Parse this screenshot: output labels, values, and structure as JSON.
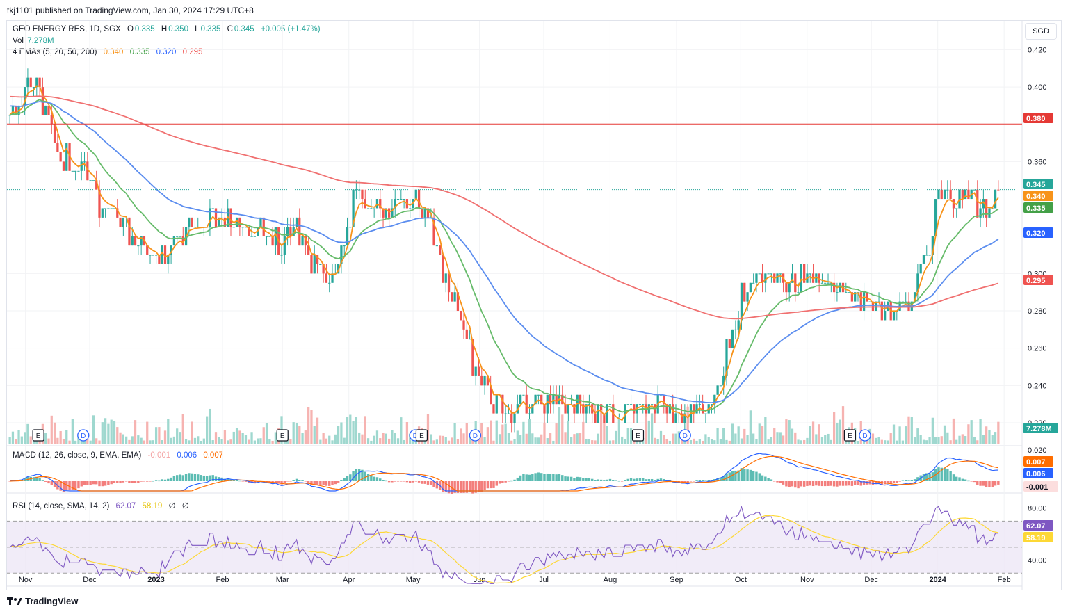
{
  "header": {
    "published": "tkj1101 published on TradingView.com, Jan 30, 2024 17:29 UTC+8",
    "symbol": "GEO ENERGY RES, 1D, SGX",
    "o_label": "O",
    "o_val": "0.335",
    "h_label": "H",
    "h_val": "0.350",
    "l_label": "L",
    "l_val": "0.335",
    "c_label": "C",
    "c_val": "0.345",
    "change": "+0.005 (+1.47%)",
    "vol_label": "Vol",
    "vol_val": "7.278M",
    "ema_label": "4 EMAs (5, 20, 50, 200)",
    "ema5": "0.340",
    "ema20": "0.335",
    "ema50": "0.320",
    "ema200": "0.295",
    "currency": "SGD"
  },
  "macd_legend": {
    "label": "MACD (12, 26, close, 9, EMA, EMA)",
    "hist": "-0.001",
    "macd": "0.006",
    "signal": "0.007"
  },
  "rsi_legend": {
    "label": "RSI (14, close, SMA, 14, 2)",
    "rsi": "62.07",
    "sma": "58.19",
    "extra1": "∅",
    "extra2": "∅"
  },
  "footer": {
    "brand": "TradingView"
  },
  "colors": {
    "up": "#26a69a",
    "down": "#ef5350",
    "ema5": "#f7931a",
    "ema20": "#66bb6a",
    "ema50": "#5b8def",
    "ema200": "#f07070",
    "level": "#e53935",
    "macd": "#2962ff",
    "signal": "#ff6d00",
    "rsi": "#7e57c2",
    "rsima": "#fdd835"
  },
  "price_axis": [
    "0.420",
    "0.400",
    "0.360",
    "0.300",
    "0.280",
    "0.260",
    "0.240",
    "0.220"
  ],
  "macd_axis": [
    "0.020"
  ],
  "rsi_axis": [
    "80.00",
    "40.00"
  ],
  "time_axis": [
    "Nov",
    "Dec",
    "2023",
    "Feb",
    "Mar",
    "Apr",
    "May",
    "Jun",
    "Jul",
    "Aug",
    "Sep",
    "Oct",
    "Nov",
    "Dec",
    "2024",
    "Feb"
  ],
  "price_tags": [
    {
      "text": "0.380",
      "color": "#e53935"
    },
    {
      "text": "0.345",
      "color": "#26a69a"
    },
    {
      "text": "0.340",
      "color": "#f7931a"
    },
    {
      "text": "0.335",
      "color": "#43a047"
    },
    {
      "text": "0.320",
      "color": "#2962ff"
    },
    {
      "text": "0.295",
      "color": "#ef5350"
    },
    {
      "text": "7.278M",
      "color": "#26a69a"
    }
  ],
  "macd_tags": [
    {
      "text": "0.007",
      "color": "#ff6d00"
    },
    {
      "text": "0.006",
      "color": "#2962ff"
    },
    {
      "text": "-0.001",
      "color": "#fcdede"
    }
  ],
  "rsi_tags": [
    {
      "text": "62.07",
      "color": "#7e57c2"
    },
    {
      "text": "58.19",
      "color": "#fdd835"
    }
  ],
  "markers": [
    {
      "month": "Nov",
      "type": "E"
    },
    {
      "month": "Nov",
      "type": "D"
    },
    {
      "month": "Mar",
      "type": "E"
    },
    {
      "month": "May",
      "type": "D"
    },
    {
      "month": "May",
      "type": "E"
    },
    {
      "month": "Jun",
      "type": "D"
    },
    {
      "month": "Aug",
      "type": "E"
    },
    {
      "month": "Sep",
      "type": "D"
    },
    {
      "month": "Nov",
      "type": "E"
    },
    {
      "month": "Nov",
      "type": "D"
    }
  ],
  "chart_data": {
    "type": "candlestick",
    "title": "GEO ENERGY RES, 1D, SGX",
    "ylim": [
      0.22,
      0.425
    ],
    "horizontal_level": 0.38,
    "last_price": 0.345,
    "close_path": [
      [
        "2022-10-24",
        0.385
      ],
      [
        "2022-11-01",
        0.405
      ],
      [
        "2022-11-07",
        0.395
      ],
      [
        "2022-11-14",
        0.365
      ],
      [
        "2022-11-21",
        0.36
      ],
      [
        "2022-11-28",
        0.36
      ],
      [
        "2022-12-05",
        0.335
      ],
      [
        "2022-12-12",
        0.33
      ],
      [
        "2022-12-19",
        0.32
      ],
      [
        "2022-12-27",
        0.315
      ],
      [
        "2023-01-03",
        0.31
      ],
      [
        "2023-01-16",
        0.325
      ],
      [
        "2023-01-30",
        0.33
      ],
      [
        "2023-02-13",
        0.325
      ],
      [
        "2023-02-27",
        0.315
      ],
      [
        "2023-03-06",
        0.325
      ],
      [
        "2023-03-20",
        0.295
      ],
      [
        "2023-03-27",
        0.31
      ],
      [
        "2023-04-03",
        0.34
      ],
      [
        "2023-04-17",
        0.335
      ],
      [
        "2023-05-02",
        0.34
      ],
      [
        "2023-05-08",
        0.33
      ],
      [
        "2023-05-15",
        0.3
      ],
      [
        "2023-05-22",
        0.275
      ],
      [
        "2023-06-01",
        0.24
      ],
      [
        "2023-06-12",
        0.225
      ],
      [
        "2023-06-26",
        0.23
      ],
      [
        "2023-07-10",
        0.23
      ],
      [
        "2023-07-24",
        0.225
      ],
      [
        "2023-08-07",
        0.225
      ],
      [
        "2023-08-21",
        0.23
      ],
      [
        "2023-09-04",
        0.225
      ],
      [
        "2023-09-18",
        0.23
      ],
      [
        "2023-09-25",
        0.26
      ],
      [
        "2023-10-02",
        0.29
      ],
      [
        "2023-10-09",
        0.3
      ],
      [
        "2023-10-23",
        0.295
      ],
      [
        "2023-11-06",
        0.3
      ],
      [
        "2023-11-20",
        0.29
      ],
      [
        "2023-12-04",
        0.28
      ],
      [
        "2023-12-18",
        0.28
      ],
      [
        "2023-12-27",
        0.31
      ],
      [
        "2024-01-02",
        0.34
      ],
      [
        "2024-01-15",
        0.34
      ],
      [
        "2024-01-22",
        0.335
      ],
      [
        "2024-01-30",
        0.345
      ]
    ],
    "ema_values_last": {
      "EMA5": 0.34,
      "EMA20": 0.335,
      "EMA50": 0.32,
      "EMA200": 0.295
    },
    "volume_last": "7.278M",
    "macd_last": {
      "macd": 0.006,
      "signal": 0.007,
      "histogram": -0.001
    },
    "rsi_last": {
      "rsi": 62.07,
      "rsi_sma": 58.19
    },
    "rsi_bands": [
      70,
      50,
      30
    ],
    "grid": true
  }
}
